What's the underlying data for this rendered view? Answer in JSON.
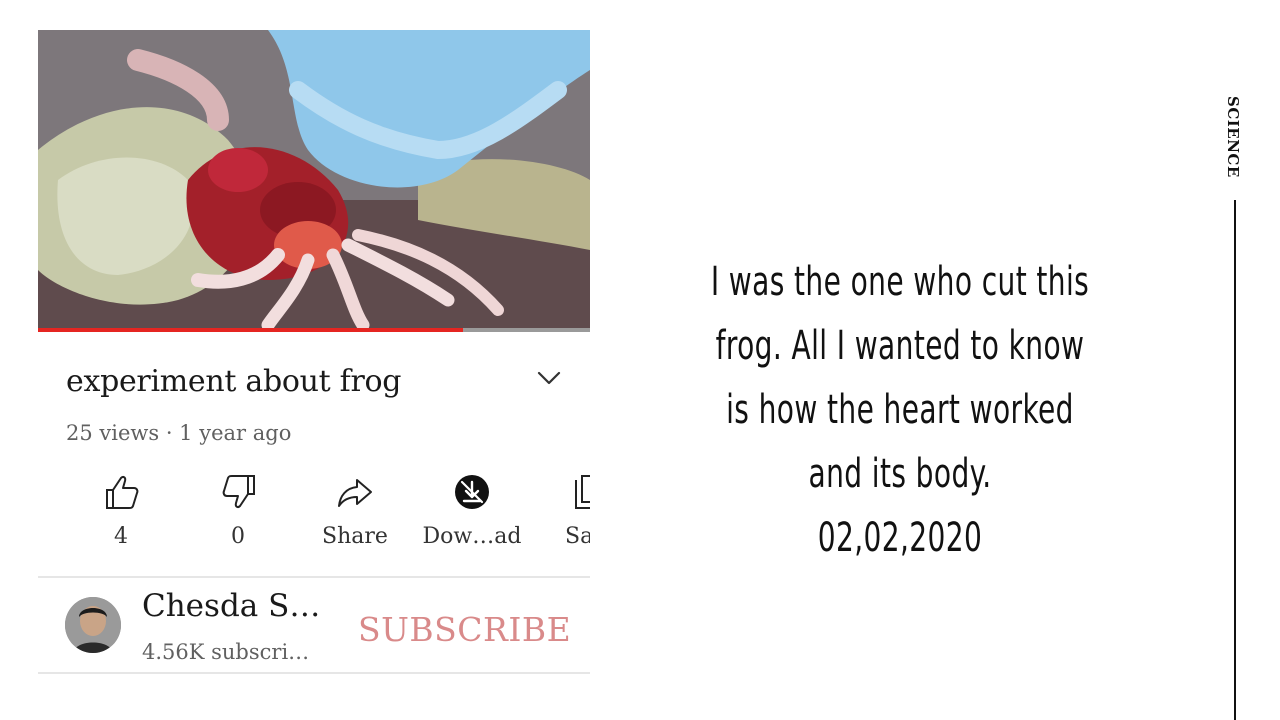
{
  "video": {
    "title": "experiment about frog",
    "meta": "25 views · 1 year ago",
    "progress": 0.77
  },
  "actions": [
    {
      "icon": "thumbs-up-icon",
      "label": "4"
    },
    {
      "icon": "thumbs-down-icon",
      "label": "0"
    },
    {
      "icon": "share-icon",
      "label": "Share"
    },
    {
      "icon": "download-icon",
      "label": "Dow…ad"
    },
    {
      "icon": "save-icon",
      "label": "Sa"
    }
  ],
  "channel": {
    "name": "Chesda S…",
    "subscribers": "4.56K subscri…",
    "subscribe_label": "SUBSCRIBE"
  },
  "caption": {
    "lines": [
      "I was the one who cut this",
      "frog. All I wanted to know",
      "is how the heart worked",
      "and its body.",
      "02,02,2020"
    ]
  },
  "side_label": "SCIENCE",
  "colors": {
    "progress": "#e52521",
    "subscribe": "#d98a8a",
    "glove": "#8fc7ea"
  }
}
